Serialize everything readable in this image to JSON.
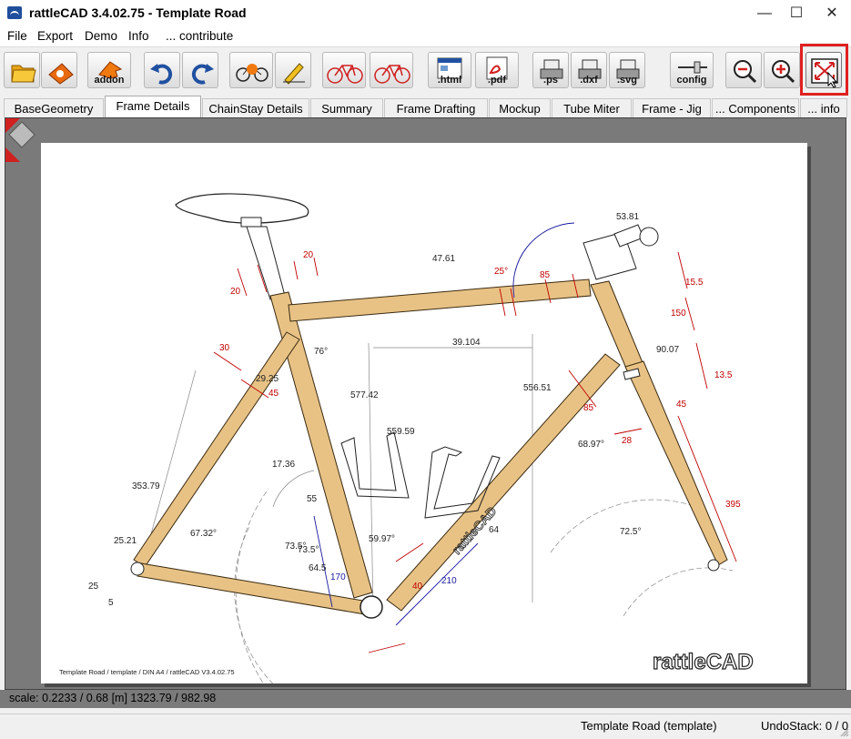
{
  "window": {
    "title": "rattleCAD  3.4.02.75 - Template Road",
    "controls": {
      "minimize": "—",
      "maximize": "☐",
      "close": "✕"
    }
  },
  "menu": [
    "File",
    "Export",
    "Demo",
    "Info",
    "... contribute"
  ],
  "toolbar": {
    "addon_label": "addon",
    "html_label": ".html",
    "pdf_label": ".pdf",
    "ps_label": ".ps",
    "dxf_label": ".dxf",
    "svg_label": ".svg",
    "config_label": "config",
    "icons": [
      "open-folder-icon",
      "save-icon",
      "addon-icon",
      "undo-icon",
      "redo-icon",
      "reset-geometry-icon",
      "rename-icon",
      "bike-compare-icon",
      "bike-overlay-icon",
      "export-html-icon",
      "export-pdf-icon",
      "export-ps-icon",
      "export-dxf-icon",
      "export-svg-icon",
      "config-icon",
      "zoom-out-icon",
      "zoom-in-icon",
      "fit-to-window-icon"
    ]
  },
  "tabs": [
    "BaseGeometry",
    "Frame Details",
    "ChainStay Details",
    "Summary",
    "Frame Drafting",
    "Mockup",
    "Tube Miter",
    "Frame - Jig",
    "... Components",
    "... info"
  ],
  "active_tab": "Frame Details",
  "drawing": {
    "dims": [
      "20",
      "20",
      "30",
      "29.25",
      "45",
      "76°",
      "73.5°",
      "39.104",
      "556.51",
      "577.42",
      "559.59",
      "47.61",
      "25°",
      "85",
      "53.81",
      "15.5",
      "150",
      "90.07",
      "13.5",
      "45",
      "68.97°",
      "28",
      "395",
      "85",
      "17.36",
      "55",
      "170",
      "73.5°",
      "64.5",
      "59.97°",
      "64",
      "210",
      "40",
      "353.79",
      "67.32°",
      "25.21",
      "25",
      "5",
      "72.5°"
    ],
    "footer_text": "Template Road  /  template  /  DIN A4  /  rattleCAD  V3.4.02.75",
    "logo_text": "rattleCAD",
    "branding": "rattleCAD"
  },
  "status": {
    "scale": "scale: 0.2233 / 0.68  [m]  1323.79 / 982.98",
    "project": "Template Road (template)",
    "undo": "UndoStack:  0 /  0"
  },
  "colors": {
    "tube": "#e8c285",
    "dim_red": "#c00000",
    "dim_blue": "#1a1aa0",
    "dim_gray": "#777777",
    "highlight": "#e02020"
  }
}
